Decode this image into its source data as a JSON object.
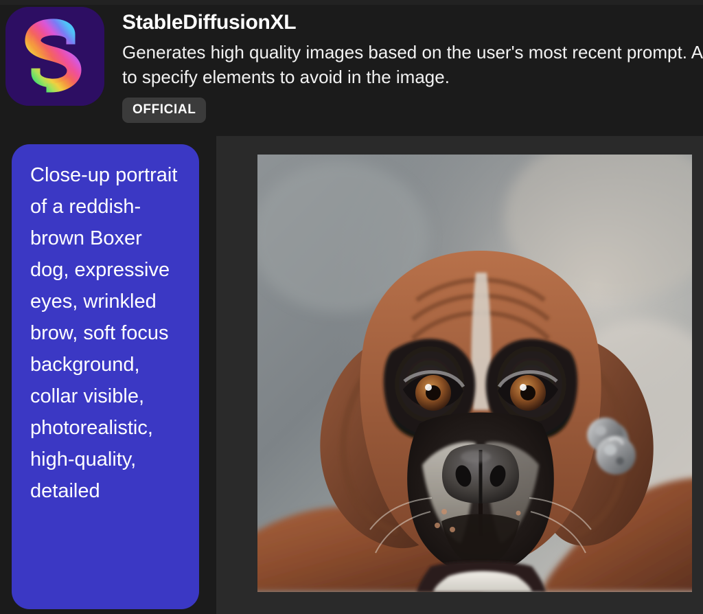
{
  "header": {
    "app_name": "StableDiffusionXL",
    "description": "Generates high quality images based on the user's most recent prompt. Allows users to specify elements to avoid in the image.",
    "badge_label": "OFFICIAL",
    "icon_name": "stablediffusion-s-logo"
  },
  "conversation": {
    "user_message": "Close-up portrait of a reddish-brown Boxer dog, expressive eyes, wrinkled brow, soft focus background, collar visible, photorealistic, high-quality, detailed"
  },
  "generated_image": {
    "alt": "Close-up photorealistic portrait of a reddish-brown Boxer dog looking at camera, blurred gray background, silver collar tags visible"
  },
  "colors": {
    "page_background": "#1a1a1a",
    "header_background": "#1b1b1b",
    "panel_background": "#2a2a2a",
    "bubble_accent": "#3b38c4",
    "badge_background": "#3b3b3b",
    "text_primary": "#ffffff",
    "icon_background": "#2d0e63"
  }
}
